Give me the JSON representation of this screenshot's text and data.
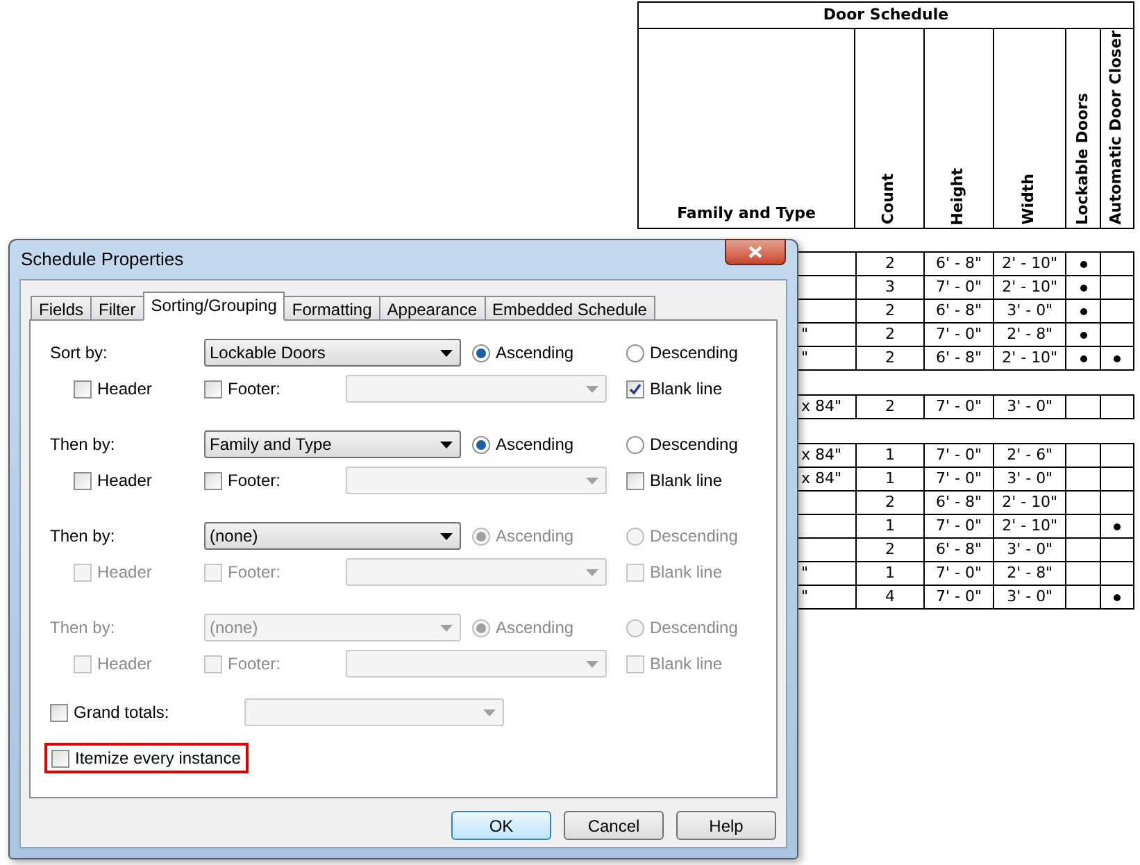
{
  "schedule": {
    "title": "Door Schedule",
    "columns": [
      "Family and Type",
      "Count",
      "Height",
      "Width",
      "Lockable Doors",
      "Automatic Door Closer"
    ],
    "rows": [
      {
        "kind": "data",
        "family": "",
        "count": "2",
        "height": "6' - 8\"",
        "width": "2' - 10\"",
        "lockable": true,
        "closer": false
      },
      {
        "kind": "data",
        "family": "",
        "count": "3",
        "height": "7' - 0\"",
        "width": "2' - 10\"",
        "lockable": true,
        "closer": false
      },
      {
        "kind": "data",
        "family": "",
        "count": "2",
        "height": "6' - 8\"",
        "width": "3' - 0\"",
        "lockable": true,
        "closer": false
      },
      {
        "kind": "data",
        "family": "\"",
        "count": "2",
        "height": "7' - 0\"",
        "width": "2' - 8\"",
        "lockable": true,
        "closer": false
      },
      {
        "kind": "data",
        "family": "\"",
        "count": "2",
        "height": "6' - 8\"",
        "width": "2' - 10\"",
        "lockable": true,
        "closer": true
      },
      {
        "kind": "blank"
      },
      {
        "kind": "data",
        "family": "x 84\"",
        "count": "2",
        "height": "7' - 0\"",
        "width": "3' - 0\"",
        "lockable": false,
        "closer": false
      },
      {
        "kind": "blank"
      },
      {
        "kind": "data",
        "family": "x 84\"",
        "count": "1",
        "height": "7' - 0\"",
        "width": "2' - 6\"",
        "lockable": false,
        "closer": false
      },
      {
        "kind": "data",
        "family": "x 84\"",
        "count": "1",
        "height": "7' - 0\"",
        "width": "3' - 0\"",
        "lockable": false,
        "closer": false
      },
      {
        "kind": "data",
        "family": "",
        "count": "2",
        "height": "6' - 8\"",
        "width": "2' - 10\"",
        "lockable": false,
        "closer": false
      },
      {
        "kind": "data",
        "family": "",
        "count": "1",
        "height": "7' - 0\"",
        "width": "2' - 10\"",
        "lockable": false,
        "closer": true
      },
      {
        "kind": "data",
        "family": "",
        "count": "2",
        "height": "6' - 8\"",
        "width": "3' - 0\"",
        "lockable": false,
        "closer": false
      },
      {
        "kind": "data",
        "family": "\"",
        "count": "1",
        "height": "7' - 0\"",
        "width": "2' - 8\"",
        "lockable": false,
        "closer": false
      },
      {
        "kind": "data",
        "family": "\"",
        "count": "4",
        "height": "7' - 0\"",
        "width": "3' - 0\"",
        "lockable": false,
        "closer": true
      }
    ]
  },
  "dialog": {
    "title": "Schedule Properties",
    "tabs": [
      {
        "label": "Fields",
        "selected": false
      },
      {
        "label": "Filter",
        "selected": false
      },
      {
        "label": "Sorting/Grouping",
        "selected": true
      },
      {
        "label": "Formatting",
        "selected": false
      },
      {
        "label": "Appearance",
        "selected": false
      },
      {
        "label": "Embedded Schedule",
        "selected": false
      }
    ],
    "sort_groups": [
      {
        "label": "Sort by:",
        "field": "Lockable Doors",
        "field_disabled": false,
        "options_disabled": false,
        "order": [
          {
            "label": "Ascending",
            "selected": true
          },
          {
            "label": "Descending",
            "selected": false
          }
        ],
        "checks": [
          {
            "label": "Header",
            "checked": false
          },
          {
            "label": "Footer:",
            "checked": false
          },
          {
            "label": "Blank line",
            "checked": true
          }
        ]
      },
      {
        "label": "Then by:",
        "field": "Family and Type",
        "field_disabled": false,
        "options_disabled": false,
        "order": [
          {
            "label": "Ascending",
            "selected": true
          },
          {
            "label": "Descending",
            "selected": false
          }
        ],
        "checks": [
          {
            "label": "Header",
            "checked": false
          },
          {
            "label": "Footer:",
            "checked": false
          },
          {
            "label": "Blank line",
            "checked": false
          }
        ]
      },
      {
        "label": "Then by:",
        "field": "(none)",
        "field_disabled": false,
        "options_disabled": true,
        "order": [
          {
            "label": "Ascending",
            "selected": true
          },
          {
            "label": "Descending",
            "selected": false
          }
        ],
        "checks": [
          {
            "label": "Header",
            "checked": false
          },
          {
            "label": "Footer:",
            "checked": false
          },
          {
            "label": "Blank line",
            "checked": false
          }
        ]
      },
      {
        "label": "Then by:",
        "field": "(none)",
        "field_disabled": true,
        "options_disabled": true,
        "order": [
          {
            "label": "Ascending",
            "selected": true
          },
          {
            "label": "Descending",
            "selected": false
          }
        ],
        "checks": [
          {
            "label": "Header",
            "checked": false
          },
          {
            "label": "Footer:",
            "checked": false
          },
          {
            "label": "Blank line",
            "checked": false
          }
        ]
      }
    ],
    "grand_totals": {
      "label": "Grand totals:",
      "checked": false
    },
    "itemize": {
      "label": "Itemize every instance",
      "checked": false,
      "highlighted": true
    },
    "buttons": [
      {
        "label": "OK",
        "default": true
      },
      {
        "label": "Cancel",
        "default": false
      },
      {
        "label": "Help",
        "default": false
      }
    ]
  }
}
